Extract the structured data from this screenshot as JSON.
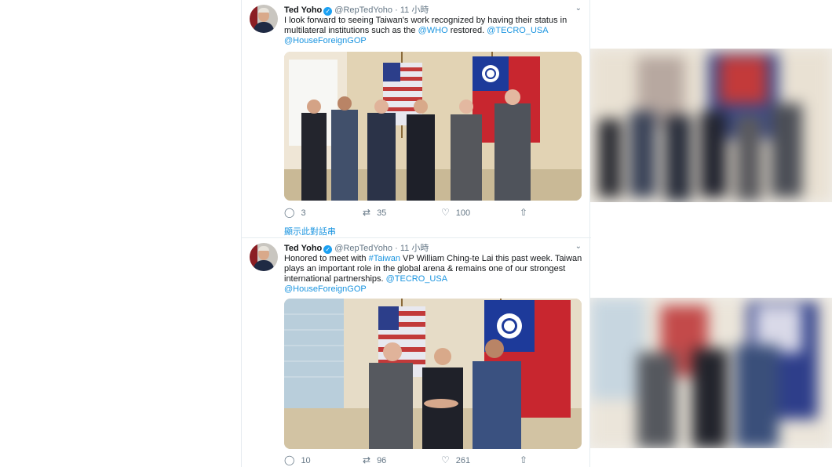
{
  "tweets": [
    {
      "author": "Ted Yoho",
      "handle": "@RepTedYoho",
      "separator": "·",
      "time": "11 小時",
      "text_parts": [
        "I look forward to seeing Taiwan's work recognized by having their status in multilateral institutions such as the ",
        "@WHO",
        " restored. ",
        "@TECRO_USA",
        "@HouseForeignGOP"
      ],
      "reply_count": "3",
      "retweet_count": "35",
      "like_count": "100"
    },
    {
      "author": "Ted Yoho",
      "handle": "@RepTedYoho",
      "separator": "·",
      "time": "11 小時",
      "text_parts": [
        "Honored to meet with ",
        "#Taiwan",
        " VP William Ching-te Lai this past week. Taiwan plays an important role in the global arena & remains one of our strongest international partnerships. ",
        "@TECRO_USA",
        "@HouseForeignGOP"
      ],
      "reply_count": "10",
      "retweet_count": "96",
      "like_count": "261"
    }
  ],
  "thread_link": "顯示此對話串",
  "icons": {
    "verified": "verified-badge-icon",
    "caret": "chevron-down-icon",
    "reply": "reply-icon",
    "retweet": "retweet-icon",
    "like": "heart-icon",
    "share": "share-icon"
  },
  "colors": {
    "link": "#1b95e0",
    "verified": "#1da1f2",
    "muted": "#657786",
    "text": "#14171a"
  }
}
